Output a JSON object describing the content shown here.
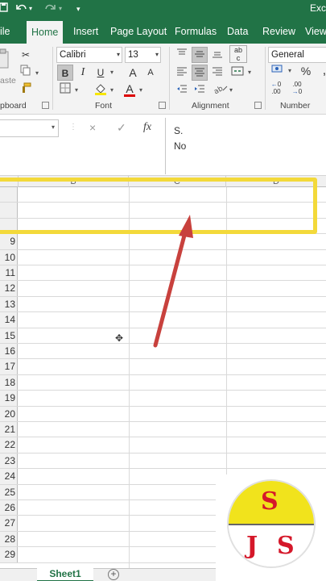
{
  "titlebar": {
    "app_title": "Exc",
    "save_icon": "save-icon",
    "undo_icon": "undo-icon",
    "redo_icon": "redo-icon",
    "customize_icon": "customize-quick-access-icon"
  },
  "tabs": {
    "file": "ile",
    "home": "Home",
    "insert": "Insert",
    "page_layout": "Page Layout",
    "formulas": "Formulas",
    "data": "Data",
    "review": "Review",
    "view": "View"
  },
  "ribbon": {
    "clipboard": {
      "label": "pboard",
      "paste_label": "aste"
    },
    "font": {
      "label": "Font",
      "name": "Calibri",
      "size": "13",
      "bold": "B",
      "italic": "I",
      "underline": "U",
      "grow": "A",
      "shrink": "A"
    },
    "alignment": {
      "label": "Alignment"
    },
    "number": {
      "label": "Number",
      "format": "General",
      "percent": "%",
      "increase_decimal": ".00",
      "decrease_decimal": ".00"
    }
  },
  "formula_bar": {
    "name_box": "",
    "cancel_icon": "×",
    "enter_icon": "✓",
    "fx": "fx",
    "content_line1": "S.",
    "content_line2": "No"
  },
  "columns": {
    "b": "B",
    "c": "C",
    "d": "D"
  },
  "rows": [
    "9",
    "10",
    "11",
    "12",
    "13",
    "14",
    "15",
    "16",
    "17",
    "18",
    "19",
    "20",
    "21",
    "22",
    "23",
    "24",
    "25",
    "26",
    "27",
    "28",
    "29"
  ],
  "top_rows": [
    "",
    "",
    ""
  ],
  "sheets": {
    "active": "Sheet1",
    "add": "+"
  },
  "logo": {
    "top_letter": "S",
    "bottom_left": "J",
    "bottom_right": "S"
  },
  "colors": {
    "accent": "#217346",
    "highlight": "#f3d93a",
    "arrow": "#c8413d",
    "logo_yellow": "#f1e31c",
    "logo_red": "#d5182a"
  }
}
